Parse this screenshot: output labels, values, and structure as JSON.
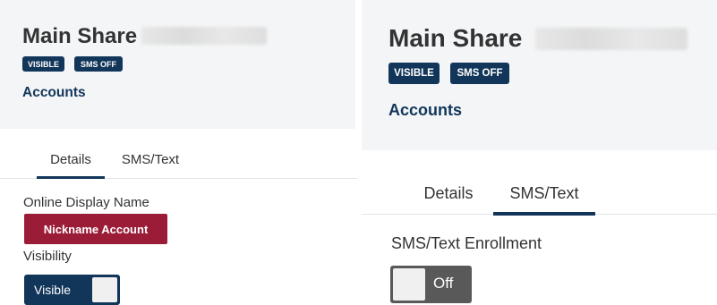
{
  "left": {
    "header": {
      "title": "Main Share",
      "badges": {
        "visible": "VISIBLE",
        "sms": "SMS OFF"
      },
      "accounts_link": "Accounts"
    },
    "tabs": [
      {
        "label": "Details",
        "active": true
      },
      {
        "label": "SMS/Text",
        "active": false
      }
    ],
    "details": {
      "display_name_label": "Online Display Name",
      "nickname_button": "Nickname Account",
      "visibility_label": "Visibility",
      "visibility_toggle": {
        "label": "Visible",
        "on": true
      }
    }
  },
  "right": {
    "header": {
      "title": "Main Share",
      "badges": {
        "visible": "VISIBLE",
        "sms": "SMS OFF"
      },
      "accounts_link": "Accounts"
    },
    "tabs": [
      {
        "label": "Details",
        "active": false
      },
      {
        "label": "SMS/Text",
        "active": true
      }
    ],
    "sms": {
      "enrollment_label": "SMS/Text Enrollment",
      "sms_toggle": {
        "label": "Off",
        "on": false
      }
    }
  },
  "colors": {
    "brand_navy": "#12365a",
    "accent_red": "#9a1c37",
    "header_bg": "#f3f5f7",
    "toggle_off": "#595959"
  }
}
